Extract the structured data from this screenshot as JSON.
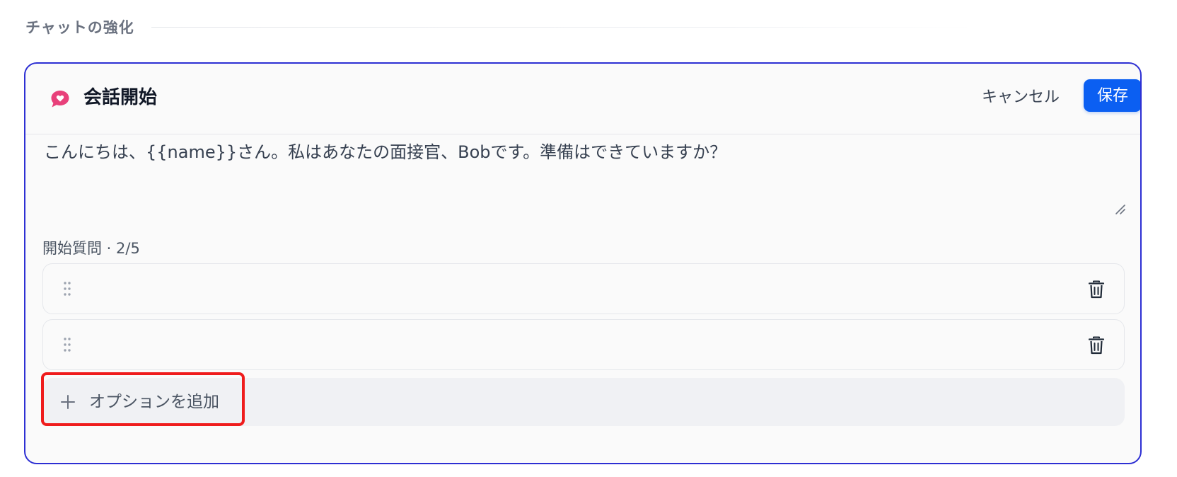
{
  "section": {
    "title": "チャットの強化"
  },
  "card": {
    "title": "会話開始",
    "icon": "chat-heart-icon",
    "cancel_label": "キャンセル",
    "save_label": "保存",
    "message": "こんにちは、{{name}}さん。私はあなたの面接官、Bobです。準備はできていますか？",
    "questions_label": "開始質問 · 2/5",
    "questions": [
      {
        "value": ""
      },
      {
        "value": ""
      }
    ],
    "add_option_label": "オプションを追加"
  },
  "colors": {
    "accent": "#0b5ff2",
    "card_border": "#2d2fd3",
    "icon_pink": "#e8407a",
    "highlight": "#ef1c1c"
  }
}
